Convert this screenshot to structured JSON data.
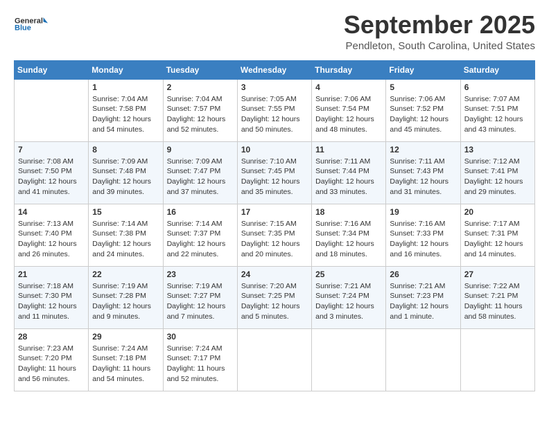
{
  "header": {
    "logo_line1": "General",
    "logo_line2": "Blue",
    "month": "September 2025",
    "location": "Pendleton, South Carolina, United States"
  },
  "weekdays": [
    "Sunday",
    "Monday",
    "Tuesday",
    "Wednesday",
    "Thursday",
    "Friday",
    "Saturday"
  ],
  "weeks": [
    [
      {
        "day": "",
        "sunrise": "",
        "sunset": "",
        "daylight": ""
      },
      {
        "day": "1",
        "sunrise": "Sunrise: 7:04 AM",
        "sunset": "Sunset: 7:58 PM",
        "daylight": "Daylight: 12 hours and 54 minutes."
      },
      {
        "day": "2",
        "sunrise": "Sunrise: 7:04 AM",
        "sunset": "Sunset: 7:57 PM",
        "daylight": "Daylight: 12 hours and 52 minutes."
      },
      {
        "day": "3",
        "sunrise": "Sunrise: 7:05 AM",
        "sunset": "Sunset: 7:55 PM",
        "daylight": "Daylight: 12 hours and 50 minutes."
      },
      {
        "day": "4",
        "sunrise": "Sunrise: 7:06 AM",
        "sunset": "Sunset: 7:54 PM",
        "daylight": "Daylight: 12 hours and 48 minutes."
      },
      {
        "day": "5",
        "sunrise": "Sunrise: 7:06 AM",
        "sunset": "Sunset: 7:52 PM",
        "daylight": "Daylight: 12 hours and 45 minutes."
      },
      {
        "day": "6",
        "sunrise": "Sunrise: 7:07 AM",
        "sunset": "Sunset: 7:51 PM",
        "daylight": "Daylight: 12 hours and 43 minutes."
      }
    ],
    [
      {
        "day": "7",
        "sunrise": "Sunrise: 7:08 AM",
        "sunset": "Sunset: 7:50 PM",
        "daylight": "Daylight: 12 hours and 41 minutes."
      },
      {
        "day": "8",
        "sunrise": "Sunrise: 7:09 AM",
        "sunset": "Sunset: 7:48 PM",
        "daylight": "Daylight: 12 hours and 39 minutes."
      },
      {
        "day": "9",
        "sunrise": "Sunrise: 7:09 AM",
        "sunset": "Sunset: 7:47 PM",
        "daylight": "Daylight: 12 hours and 37 minutes."
      },
      {
        "day": "10",
        "sunrise": "Sunrise: 7:10 AM",
        "sunset": "Sunset: 7:45 PM",
        "daylight": "Daylight: 12 hours and 35 minutes."
      },
      {
        "day": "11",
        "sunrise": "Sunrise: 7:11 AM",
        "sunset": "Sunset: 7:44 PM",
        "daylight": "Daylight: 12 hours and 33 minutes."
      },
      {
        "day": "12",
        "sunrise": "Sunrise: 7:11 AM",
        "sunset": "Sunset: 7:43 PM",
        "daylight": "Daylight: 12 hours and 31 minutes."
      },
      {
        "day": "13",
        "sunrise": "Sunrise: 7:12 AM",
        "sunset": "Sunset: 7:41 PM",
        "daylight": "Daylight: 12 hours and 29 minutes."
      }
    ],
    [
      {
        "day": "14",
        "sunrise": "Sunrise: 7:13 AM",
        "sunset": "Sunset: 7:40 PM",
        "daylight": "Daylight: 12 hours and 26 minutes."
      },
      {
        "day": "15",
        "sunrise": "Sunrise: 7:14 AM",
        "sunset": "Sunset: 7:38 PM",
        "daylight": "Daylight: 12 hours and 24 minutes."
      },
      {
        "day": "16",
        "sunrise": "Sunrise: 7:14 AM",
        "sunset": "Sunset: 7:37 PM",
        "daylight": "Daylight: 12 hours and 22 minutes."
      },
      {
        "day": "17",
        "sunrise": "Sunrise: 7:15 AM",
        "sunset": "Sunset: 7:35 PM",
        "daylight": "Daylight: 12 hours and 20 minutes."
      },
      {
        "day": "18",
        "sunrise": "Sunrise: 7:16 AM",
        "sunset": "Sunset: 7:34 PM",
        "daylight": "Daylight: 12 hours and 18 minutes."
      },
      {
        "day": "19",
        "sunrise": "Sunrise: 7:16 AM",
        "sunset": "Sunset: 7:33 PM",
        "daylight": "Daylight: 12 hours and 16 minutes."
      },
      {
        "day": "20",
        "sunrise": "Sunrise: 7:17 AM",
        "sunset": "Sunset: 7:31 PM",
        "daylight": "Daylight: 12 hours and 14 minutes."
      }
    ],
    [
      {
        "day": "21",
        "sunrise": "Sunrise: 7:18 AM",
        "sunset": "Sunset: 7:30 PM",
        "daylight": "Daylight: 12 hours and 11 minutes."
      },
      {
        "day": "22",
        "sunrise": "Sunrise: 7:19 AM",
        "sunset": "Sunset: 7:28 PM",
        "daylight": "Daylight: 12 hours and 9 minutes."
      },
      {
        "day": "23",
        "sunrise": "Sunrise: 7:19 AM",
        "sunset": "Sunset: 7:27 PM",
        "daylight": "Daylight: 12 hours and 7 minutes."
      },
      {
        "day": "24",
        "sunrise": "Sunrise: 7:20 AM",
        "sunset": "Sunset: 7:25 PM",
        "daylight": "Daylight: 12 hours and 5 minutes."
      },
      {
        "day": "25",
        "sunrise": "Sunrise: 7:21 AM",
        "sunset": "Sunset: 7:24 PM",
        "daylight": "Daylight: 12 hours and 3 minutes."
      },
      {
        "day": "26",
        "sunrise": "Sunrise: 7:21 AM",
        "sunset": "Sunset: 7:23 PM",
        "daylight": "Daylight: 12 hours and 1 minute."
      },
      {
        "day": "27",
        "sunrise": "Sunrise: 7:22 AM",
        "sunset": "Sunset: 7:21 PM",
        "daylight": "Daylight: 11 hours and 58 minutes."
      }
    ],
    [
      {
        "day": "28",
        "sunrise": "Sunrise: 7:23 AM",
        "sunset": "Sunset: 7:20 PM",
        "daylight": "Daylight: 11 hours and 56 minutes."
      },
      {
        "day": "29",
        "sunrise": "Sunrise: 7:24 AM",
        "sunset": "Sunset: 7:18 PM",
        "daylight": "Daylight: 11 hours and 54 minutes."
      },
      {
        "day": "30",
        "sunrise": "Sunrise: 7:24 AM",
        "sunset": "Sunset: 7:17 PM",
        "daylight": "Daylight: 11 hours and 52 minutes."
      },
      {
        "day": "",
        "sunrise": "",
        "sunset": "",
        "daylight": ""
      },
      {
        "day": "",
        "sunrise": "",
        "sunset": "",
        "daylight": ""
      },
      {
        "day": "",
        "sunrise": "",
        "sunset": "",
        "daylight": ""
      },
      {
        "day": "",
        "sunrise": "",
        "sunset": "",
        "daylight": ""
      }
    ]
  ]
}
